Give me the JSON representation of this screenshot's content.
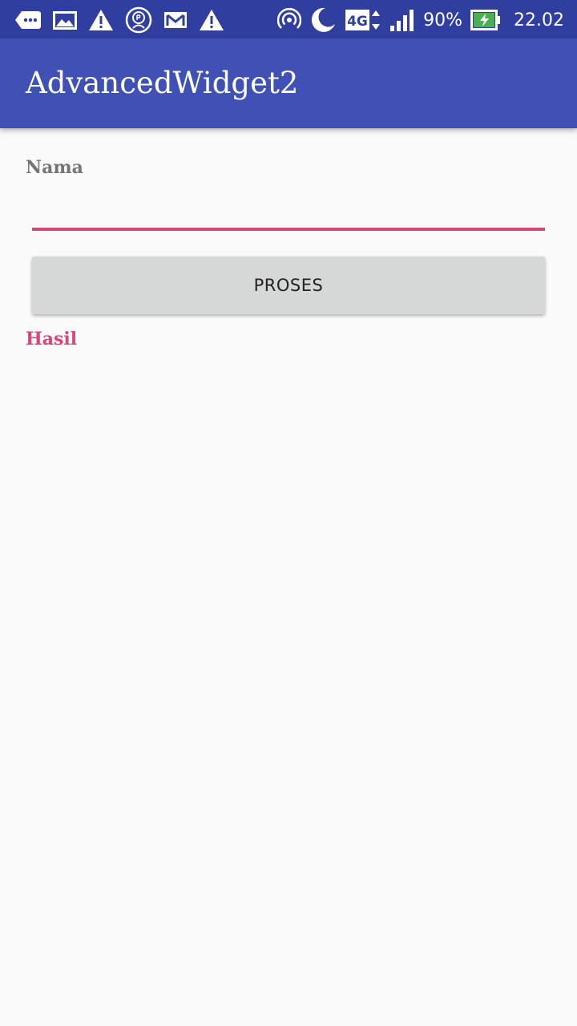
{
  "status_bar": {
    "battery_percent": "90%",
    "time": "22.02",
    "network_type": "4G",
    "left_icons": [
      "chat-dots-icon",
      "image-icon",
      "warning-icon",
      "rp-circle-icon",
      "gmail-icon",
      "warning-icon"
    ],
    "right_icons": [
      "hotspot-icon",
      "moon-icon",
      "network-4g-icon",
      "signal-icon",
      "battery-charging-icon"
    ],
    "colors": {
      "background": "#303f9f",
      "battery_fill": "#4caf50"
    }
  },
  "app_bar": {
    "title": "AdvancedWidget2",
    "color": "#3f51b5"
  },
  "form": {
    "name_label": "Nama",
    "name_value": "",
    "submit_label": "PROSES",
    "result_text": "Hasil",
    "accent_color": "#d9467a"
  }
}
